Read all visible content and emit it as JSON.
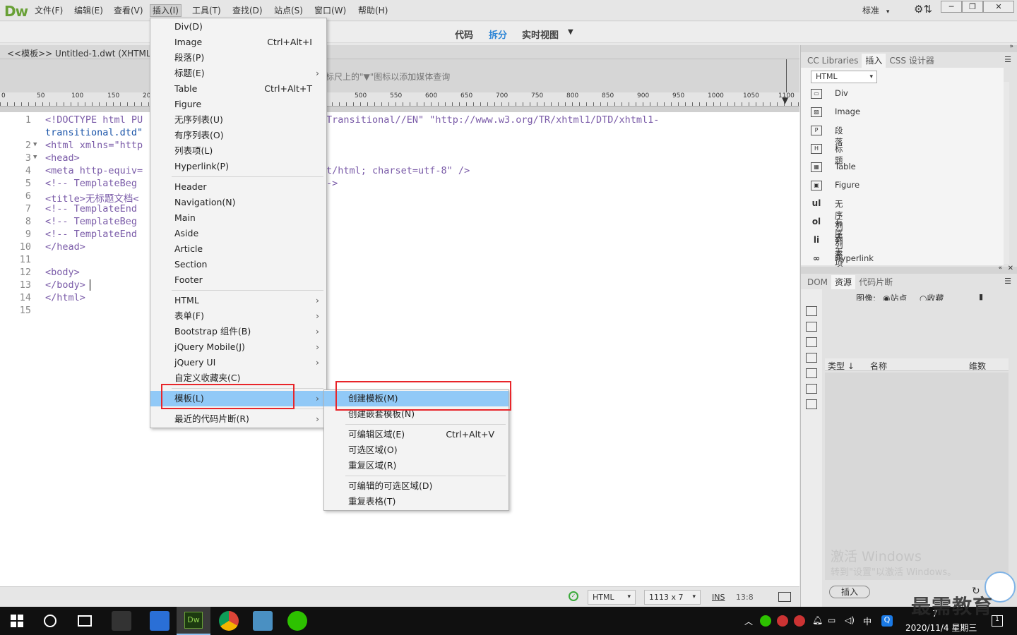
{
  "app": {
    "logo": "Dw",
    "menu": [
      "文件(F)",
      "编辑(E)",
      "查看(V)",
      "插入(I)",
      "工具(T)",
      "查找(D)",
      "站点(S)",
      "窗口(W)",
      "帮助(H)"
    ],
    "workspace": "标准",
    "win_buttons": [
      "─",
      "❐",
      "✕"
    ]
  },
  "views": [
    "代码",
    "拆分",
    "实时视图"
  ],
  "doc": {
    "tab": "<<模板>> Untitled-1.dwt (XHTML",
    "media_hint": "标尺上的\"▼\"图标以添加媒体查询",
    "ruler_ticks": [
      "0",
      "50",
      "100",
      "150",
      "20",
      "500",
      "550",
      "600",
      "650",
      "700",
      "750",
      "800",
      "850",
      "900",
      "950",
      "1000",
      "1050",
      "1100"
    ]
  },
  "code_lines": [
    {
      "n": "1",
      "fold": "",
      "text": "<!DOCTYPE html PU",
      "right": "Transitional//EN\" \"http://www.w3.org/TR/xhtml1/DTD/xhtml1-"
    },
    {
      "n": "",
      "fold": "",
      "text": "transitional.dtd\"",
      "right": ""
    },
    {
      "n": "2",
      "fold": "▼",
      "text": "<html xmlns=\"http",
      "right": ""
    },
    {
      "n": "3",
      "fold": "▼",
      "text": "<head>",
      "right": ""
    },
    {
      "n": "4",
      "fold": "",
      "text": "<meta http-equiv=",
      "right": "t/html; charset=utf-8\" />"
    },
    {
      "n": "5",
      "fold": "",
      "text": "<!-- TemplateBeg",
      "right": "->"
    },
    {
      "n": "6",
      "fold": "",
      "text": "<title>无标题文档<",
      "right": ""
    },
    {
      "n": "7",
      "fold": "",
      "text": "<!-- TemplateEnd",
      "right": ""
    },
    {
      "n": "8",
      "fold": "",
      "text": "<!-- TemplateBeg",
      "right": ""
    },
    {
      "n": "9",
      "fold": "",
      "text": "<!-- TemplateEnd",
      "right": ""
    },
    {
      "n": "10",
      "fold": "",
      "text": "</head>",
      "right": ""
    },
    {
      "n": "11",
      "fold": "",
      "text": "",
      "right": ""
    },
    {
      "n": "12",
      "fold": "",
      "text": "<body>",
      "right": ""
    },
    {
      "n": "13",
      "fold": "",
      "text": "</body>",
      "right": ""
    },
    {
      "n": "14",
      "fold": "",
      "text": "</html>",
      "right": ""
    },
    {
      "n": "15",
      "fold": "",
      "text": "",
      "right": ""
    }
  ],
  "status": {
    "lang": "HTML",
    "size": "1113 x 7",
    "mode": "INS",
    "pos": "13:8"
  },
  "insert_menu": {
    "group1": [
      {
        "label": "Div(D)",
        "shortcut": "",
        "sub": false
      },
      {
        "label": "Image",
        "shortcut": "Ctrl+Alt+I",
        "sub": false
      },
      {
        "label": "段落(P)",
        "shortcut": "",
        "sub": false
      },
      {
        "label": "标题(E)",
        "shortcut": "",
        "sub": true
      },
      {
        "label": "Table",
        "shortcut": "Ctrl+Alt+T",
        "sub": false
      },
      {
        "label": "Figure",
        "shortcut": "",
        "sub": false
      },
      {
        "label": "无序列表(U)",
        "shortcut": "",
        "sub": false
      },
      {
        "label": "有序列表(O)",
        "shortcut": "",
        "sub": false
      },
      {
        "label": "列表项(L)",
        "shortcut": "",
        "sub": false
      },
      {
        "label": "Hyperlink(P)",
        "shortcut": "",
        "sub": false
      }
    ],
    "group2": [
      "Header",
      "Navigation(N)",
      "Main",
      "Aside",
      "Article",
      "Section",
      "Footer"
    ],
    "group3": [
      {
        "label": "HTML",
        "sub": true
      },
      {
        "label": "表单(F)",
        "sub": true
      },
      {
        "label": "Bootstrap 组件(B)",
        "sub": true
      },
      {
        "label": "jQuery Mobile(J)",
        "sub": true
      },
      {
        "label": "jQuery UI",
        "sub": true
      },
      {
        "label": "自定义收藏夹(C)",
        "sub": false
      }
    ],
    "template": "模板(L)",
    "recent": "最近的代码片断(R)"
  },
  "template_menu": {
    "items": [
      "创建模板(M)",
      "创建嵌套模板(N)"
    ],
    "group2": [
      {
        "label": "可编辑区域(E)",
        "shortcut": "Ctrl+Alt+V"
      },
      {
        "label": "可选区域(O)",
        "shortcut": ""
      },
      {
        "label": "重复区域(R)",
        "shortcut": ""
      }
    ],
    "group3": [
      "可编辑的可选区域(D)",
      "重复表格(T)"
    ]
  },
  "panel": {
    "tabs": [
      "CC Libraries",
      "插入",
      "CSS 设计器"
    ],
    "category": "HTML",
    "insert_items": [
      {
        "icon": "div-icon",
        "glyph": "▭",
        "label": "Div",
        "kind": "box"
      },
      {
        "icon": "image-icon",
        "glyph": "▨",
        "label": "Image",
        "kind": "box"
      },
      {
        "icon": "paragraph-icon",
        "glyph": "P",
        "label": "段落",
        "kind": "box"
      },
      {
        "icon": "heading-icon",
        "glyph": "H",
        "label": "标题",
        "kind": "box"
      },
      {
        "icon": "table-icon",
        "glyph": "▦",
        "label": "Table",
        "kind": "box"
      },
      {
        "icon": "figure-icon",
        "glyph": "▣",
        "label": "Figure",
        "kind": "box"
      },
      {
        "icon": "ul-icon",
        "glyph": "ul",
        "label": "无序列表",
        "kind": "txt"
      },
      {
        "icon": "ol-icon",
        "glyph": "ol",
        "label": "有序列表",
        "kind": "txt"
      },
      {
        "icon": "li-icon",
        "glyph": "li",
        "label": "列表项",
        "kind": "txt"
      },
      {
        "icon": "hyperlink-icon",
        "glyph": "∞",
        "label": "Hyperlink",
        "kind": "txt"
      }
    ],
    "lower_tabs": [
      "DOM",
      "资源",
      "代码片断"
    ],
    "assets": {
      "label": "图像:",
      "site": "站点",
      "fav": "收藏",
      "columns": [
        "类型 ↓",
        "名称",
        "维数"
      ],
      "insert_button": "插入"
    },
    "watermark": [
      "激活 Windows",
      "转到\"设置\"以激活 Windows。"
    ]
  },
  "taskbar": {
    "time": "7",
    "date": "2020/11/4 星期三",
    "ime": "中",
    "brand": "最需教育"
  },
  "colors": {
    "accent": "#2f86d6",
    "highlight": "#91c9f7",
    "annotation": "#e8252a",
    "dw_green": "#68a036"
  }
}
